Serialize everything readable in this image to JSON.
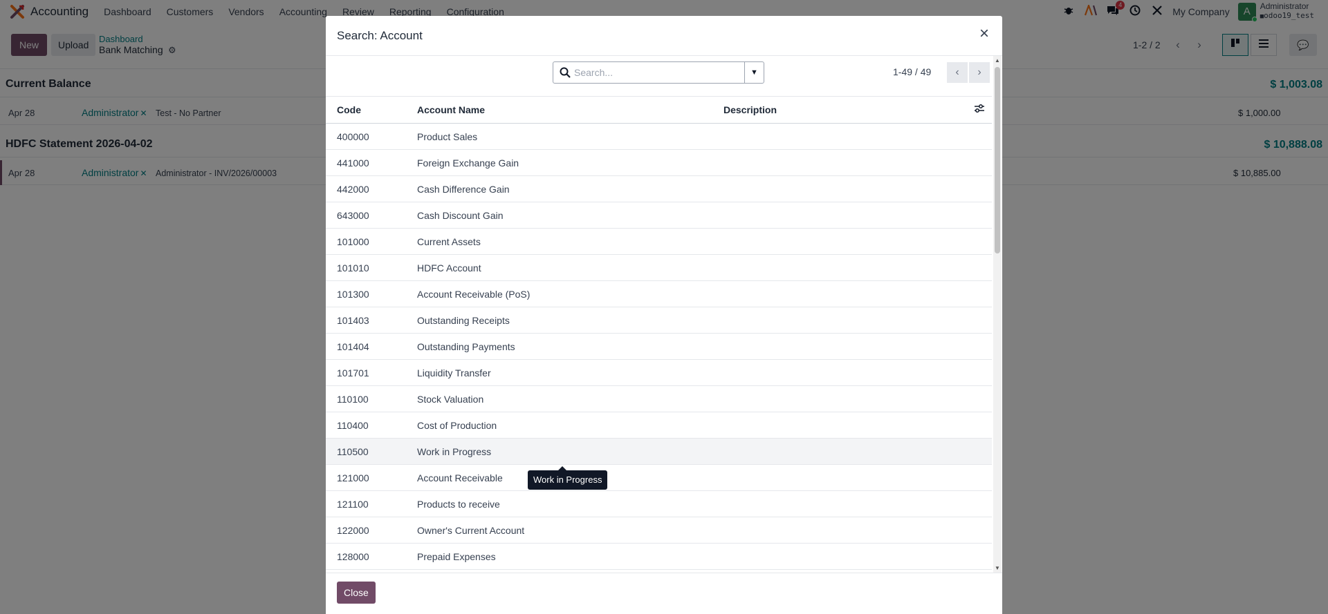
{
  "navbar": {
    "app_title": "Accounting",
    "menu": [
      "Dashboard",
      "Customers",
      "Vendors",
      "Accounting",
      "Review",
      "Reporting",
      "Configuration"
    ],
    "messages_badge": "4",
    "company": "My Company",
    "avatar_letter": "A",
    "user_name": "Administrator",
    "db_name": "odoo19_test"
  },
  "control": {
    "new_label": "New",
    "upload_label": "Upload",
    "breadcrumb_parent": "Dashboard",
    "breadcrumb_current": "Bank Matching",
    "pager": "1-2 / 2"
  },
  "groups": [
    {
      "title": "Current Balance",
      "amount": "$ 1,003.08",
      "line": {
        "date": "Apr 28",
        "partner": "Administrator",
        "label": "Test - No Partner",
        "amount": "$ 1,000.00"
      }
    },
    {
      "title": "HDFC Statement 2026-04-02",
      "amount": "$ 10,888.08",
      "line": {
        "date": "Apr 28",
        "partner": "Administrator",
        "label": "Administrator - INV/2026/00003",
        "amount": "$ 10,885.00"
      }
    }
  ],
  "modal": {
    "title": "Search: Account",
    "search_placeholder": "Search...",
    "pager": "1-49 / 49",
    "columns": {
      "code": "Code",
      "name": "Account Name",
      "description": "Description"
    },
    "rows": [
      {
        "code": "400000",
        "name": "Product Sales"
      },
      {
        "code": "441000",
        "name": "Foreign Exchange Gain"
      },
      {
        "code": "442000",
        "name": "Cash Difference Gain"
      },
      {
        "code": "643000",
        "name": "Cash Discount Gain"
      },
      {
        "code": "101000",
        "name": "Current Assets"
      },
      {
        "code": "101010",
        "name": "HDFC Account"
      },
      {
        "code": "101300",
        "name": "Account Receivable (PoS)"
      },
      {
        "code": "101403",
        "name": "Outstanding Receipts"
      },
      {
        "code": "101404",
        "name": "Outstanding Payments"
      },
      {
        "code": "101701",
        "name": "Liquidity Transfer"
      },
      {
        "code": "110100",
        "name": "Stock Valuation"
      },
      {
        "code": "110400",
        "name": "Cost of Production"
      },
      {
        "code": "110500",
        "name": "Work in Progress"
      },
      {
        "code": "121000",
        "name": "Account Receivable"
      },
      {
        "code": "121100",
        "name": "Products to receive"
      },
      {
        "code": "122000",
        "name": "Owner's Current Account"
      },
      {
        "code": "128000",
        "name": "Prepaid Expenses"
      }
    ],
    "close_label": "Close",
    "tooltip": "Work in Progress"
  }
}
